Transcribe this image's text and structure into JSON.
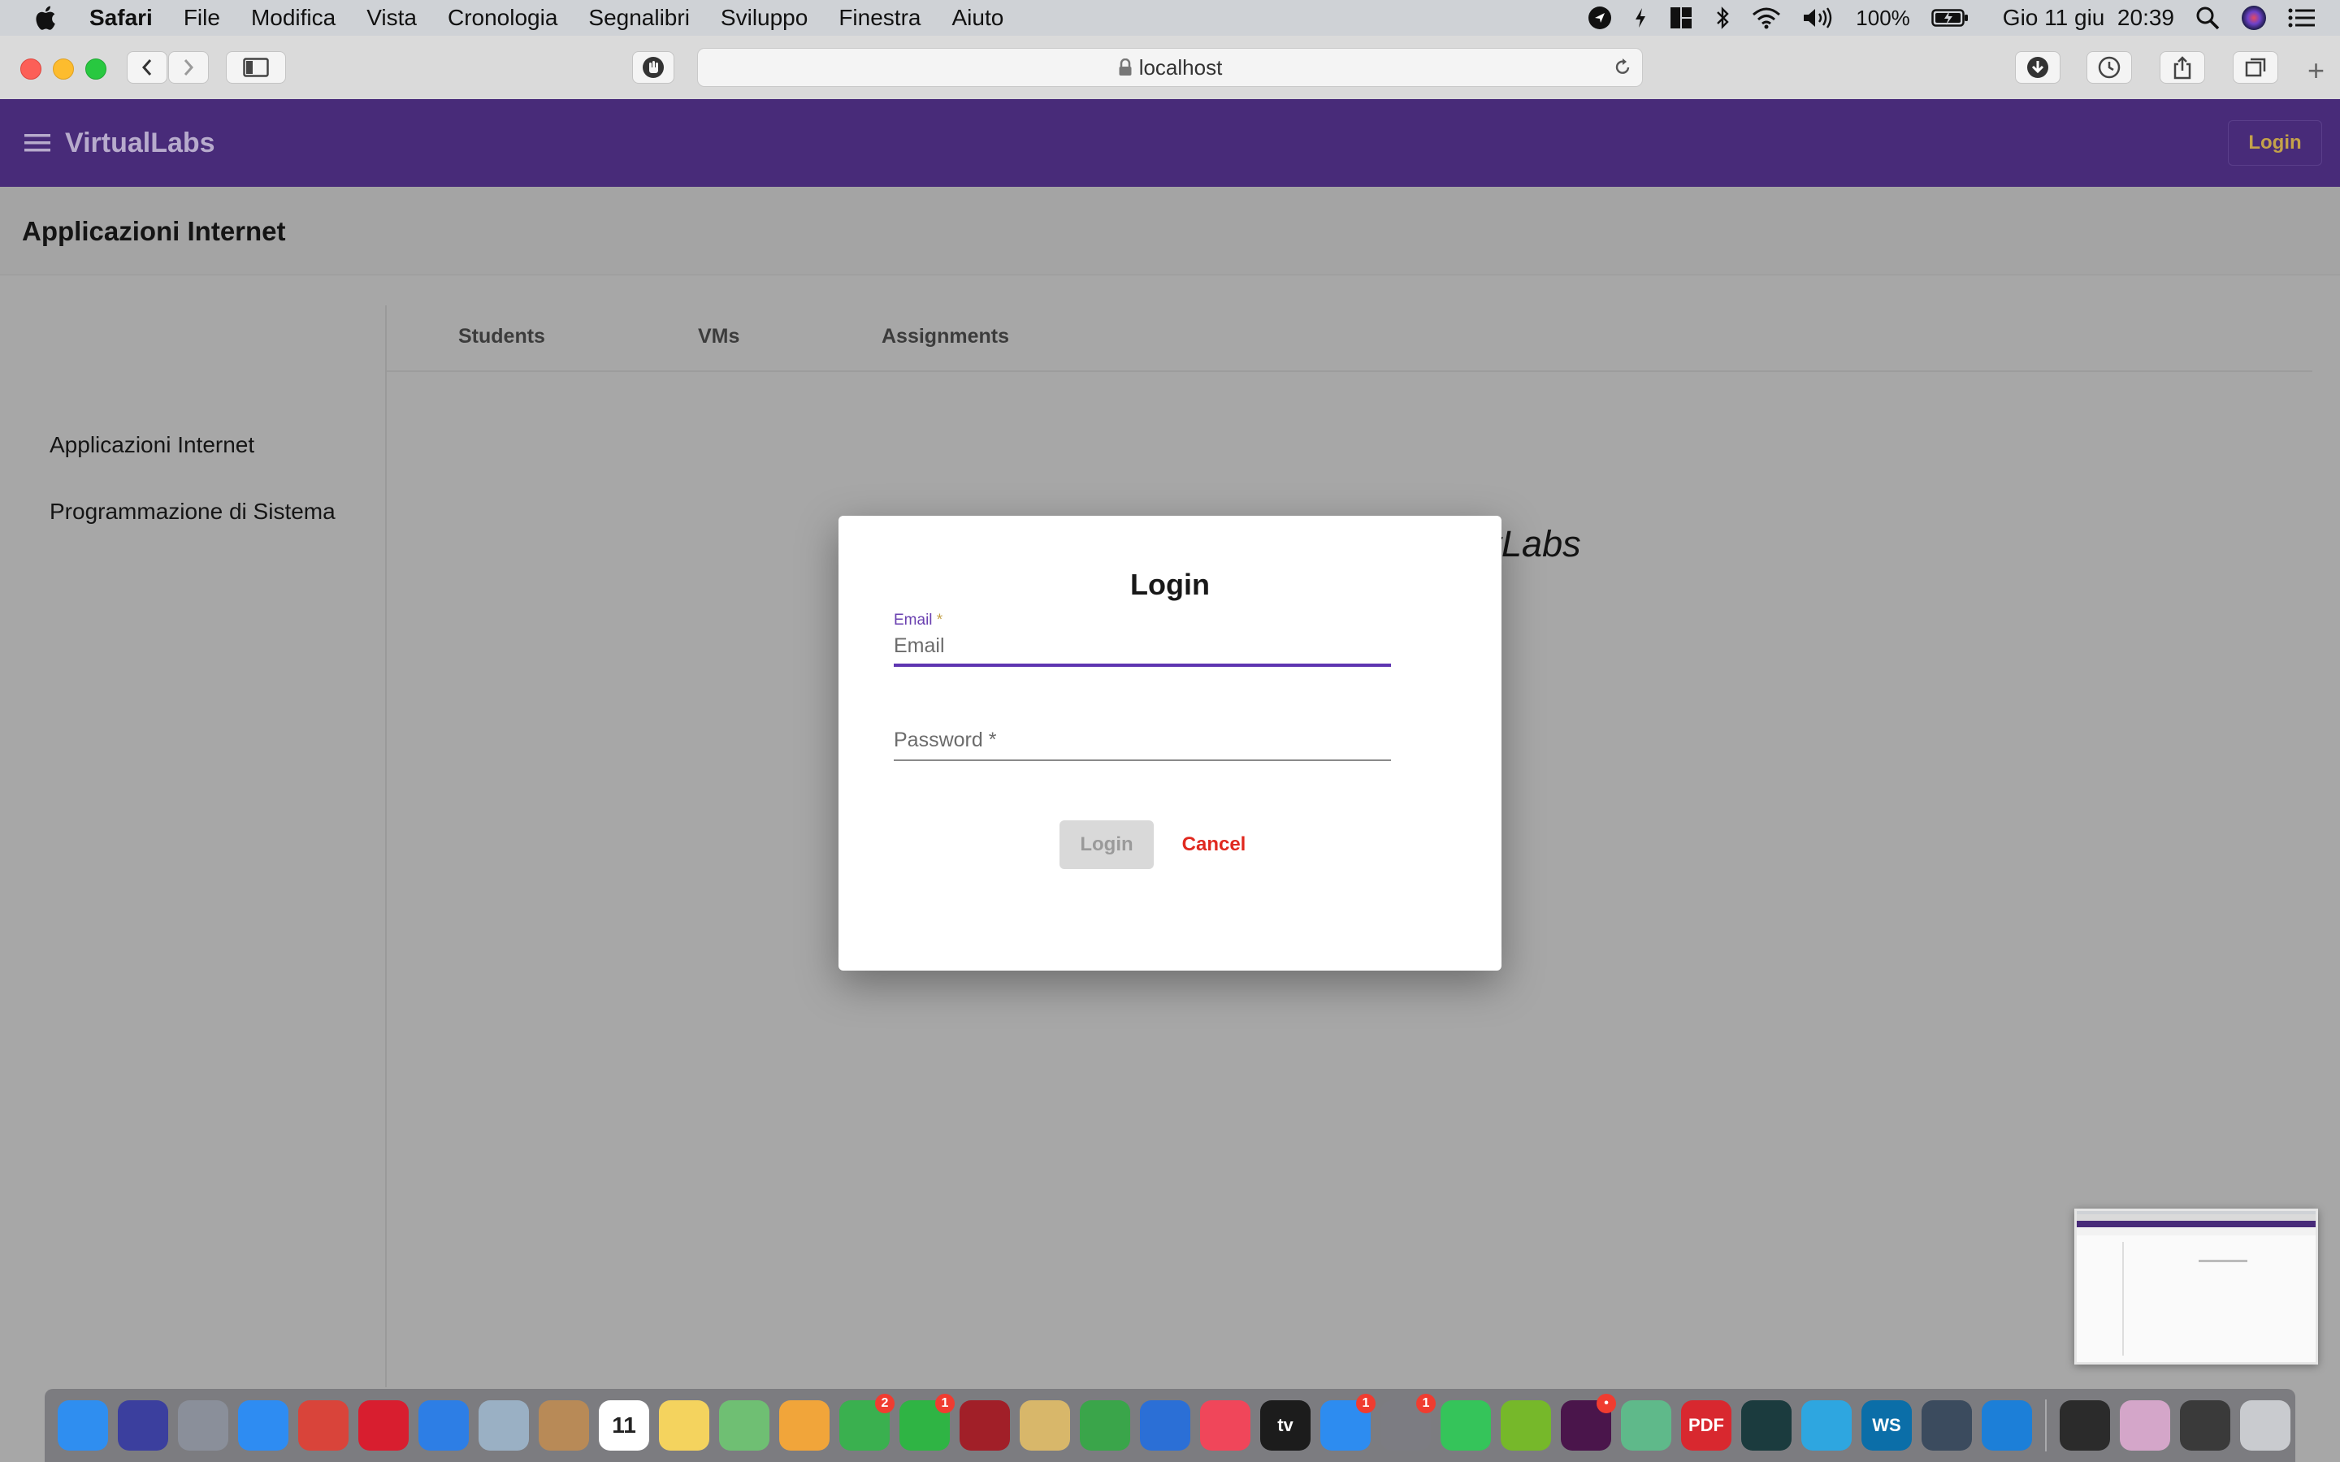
{
  "menubar": {
    "app_name": "Safari",
    "items": [
      "File",
      "Modifica",
      "Vista",
      "Cronologia",
      "Segnalibri",
      "Sviluppo",
      "Finestra",
      "Aiuto"
    ],
    "battery": "100%",
    "datetime": "Gio 11 giu  20:39",
    "status_icons": [
      "location-icon",
      "bolt-icon",
      "tiles-icon",
      "bluetooth-icon",
      "wifi-icon",
      "volume-icon",
      "battery-icon",
      "search-icon",
      "siri-icon",
      "control-center-icon"
    ]
  },
  "browser": {
    "address": "localhost",
    "lock": "locked"
  },
  "app": {
    "brand": "VirtualLabs",
    "login_button": "Login",
    "page_title": "Applicazioni Internet",
    "courses": [
      "Applicazioni Internet",
      "Programmazione di Sistema"
    ],
    "tabs": [
      "Students",
      "VMs",
      "Assignments"
    ],
    "welcome": "Welcome back on VirtLabs",
    "accent_color": "#482b79"
  },
  "dialog": {
    "title": "Login",
    "email_label": "Email",
    "email_required_mark": "*",
    "email_placeholder": "Email",
    "password_placeholder": "Password *",
    "login_button": "Login",
    "cancel_button": "Cancel"
  },
  "dock": {
    "icons": [
      {
        "name": "finder-icon",
        "color": "#2f8ef0",
        "glyph": ""
      },
      {
        "name": "siri-icon",
        "color": "#3b3f9e",
        "glyph": ""
      },
      {
        "name": "launchpad-icon",
        "color": "#8a8f9a",
        "glyph": ""
      },
      {
        "name": "safari-icon",
        "color": "#2e8cf2",
        "glyph": ""
      },
      {
        "name": "chrome-icon",
        "color": "#d9443a",
        "glyph": ""
      },
      {
        "name": "opera-icon",
        "color": "#d81e2f",
        "glyph": ""
      },
      {
        "name": "spark-icon",
        "color": "#2d7ee5",
        "glyph": ""
      },
      {
        "name": "migration-icon",
        "color": "#9ab0c4",
        "glyph": ""
      },
      {
        "name": "contacts-icon",
        "color": "#b88a57",
        "glyph": ""
      },
      {
        "name": "calendar-icon",
        "color": "#ffffff",
        "glyph": "11"
      },
      {
        "name": "notes-icon",
        "color": "#f4d35e",
        "glyph": ""
      },
      {
        "name": "maps-icon",
        "color": "#6fbf73",
        "glyph": ""
      },
      {
        "name": "photos-icon",
        "color": "#f1a53a",
        "glyph": ""
      },
      {
        "name": "messages-icon",
        "color": "#3ab04f",
        "glyph": "",
        "badge": "2"
      },
      {
        "name": "facetime-icon",
        "color": "#2fb444",
        "glyph": "",
        "badge": "1"
      },
      {
        "name": "photo-booth-icon",
        "color": "#a11f28",
        "glyph": ""
      },
      {
        "name": "preview-icon",
        "color": "#d8b76a",
        "glyph": ""
      },
      {
        "name": "numbers-icon",
        "color": "#3aa54a",
        "glyph": ""
      },
      {
        "name": "keynote-icon",
        "color": "#2b6fd6",
        "glyph": ""
      },
      {
        "name": "music-icon",
        "color": "#f0465a",
        "glyph": ""
      },
      {
        "name": "tv-icon",
        "color": "#1c1c1c",
        "glyph": "tv"
      },
      {
        "name": "app-store-icon",
        "color": "#2d8cf0",
        "glyph": "",
        "badge": "1"
      },
      {
        "name": "system-preferences-icon",
        "color": "#7c7c82",
        "glyph": "",
        "badge": "1"
      },
      {
        "name": "whatsapp-icon",
        "color": "#35c45a",
        "glyph": ""
      },
      {
        "name": "utorrent-icon",
        "color": "#76b82a",
        "glyph": ""
      },
      {
        "name": "slack-icon",
        "color": "#4a154b",
        "glyph": "",
        "badge": "•"
      },
      {
        "name": "atom-icon",
        "color": "#5fb98a",
        "glyph": ""
      },
      {
        "name": "pdf-icon",
        "color": "#d8282f",
        "glyph": "PDF"
      },
      {
        "name": "gitkraken-icon",
        "color": "#1b3b3e",
        "glyph": ""
      },
      {
        "name": "telegram-icon",
        "color": "#2ea6e0",
        "glyph": ""
      },
      {
        "name": "webstorm-icon",
        "color": "#0b6ea8",
        "glyph": "WS"
      },
      {
        "name": "quicktime-icon",
        "color": "#3b4b5e",
        "glyph": ""
      },
      {
        "name": "xcode-icon",
        "color": "#1c7fd8",
        "glyph": ""
      },
      {
        "name": "terminal-icon",
        "color": "#2b2b2b",
        "glyph": ""
      },
      {
        "name": "colorsync-icon",
        "color": "#d4a6c9",
        "glyph": ""
      },
      {
        "name": "screen-icon",
        "color": "#3a3a3a",
        "glyph": ""
      },
      {
        "name": "trash-icon",
        "color": "#c9cbcf",
        "glyph": ""
      }
    ]
  }
}
